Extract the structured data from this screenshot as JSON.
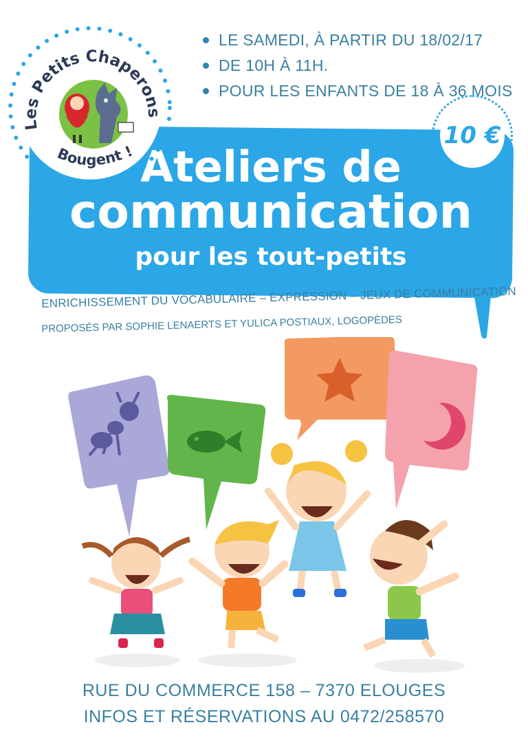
{
  "info": {
    "items": [
      "LE SAMEDI, À PARTIR DU 18/02/17",
      "DE 10H À 11H.",
      "POUR LES ENFANTS DE 18 À 36 MOIS"
    ]
  },
  "price": "10 €",
  "logo": {
    "line1": "Les Petits Chaperons",
    "line2": "Bougent !"
  },
  "title": {
    "line1": "Ateliers de",
    "line2": "communication",
    "line3": "pour les tout-petits"
  },
  "subtitle": {
    "topics": "ENRICHISSEMENT DU VOCABULAIRE – EXPRESSION – JEUX DE COMMUNICATION",
    "presenters": "PROPOSÉS PAR SOPHIE LENAERTS ET YULICA POSTIAUX, LOGOPÈDES"
  },
  "footer": {
    "address": "RUE DU COMMERCE 158 – 7370 ELOUGES",
    "contact": "INFOS ET RÉSERVATIONS AU 0472/258570"
  },
  "colors": {
    "banner": "#2ba6e6",
    "text": "#3a7fa0",
    "bubble_purple": "#a9a8d8",
    "bubble_green": "#62b54a",
    "bubble_orange": "#f39a63",
    "bubble_pink": "#f4a3ad"
  }
}
